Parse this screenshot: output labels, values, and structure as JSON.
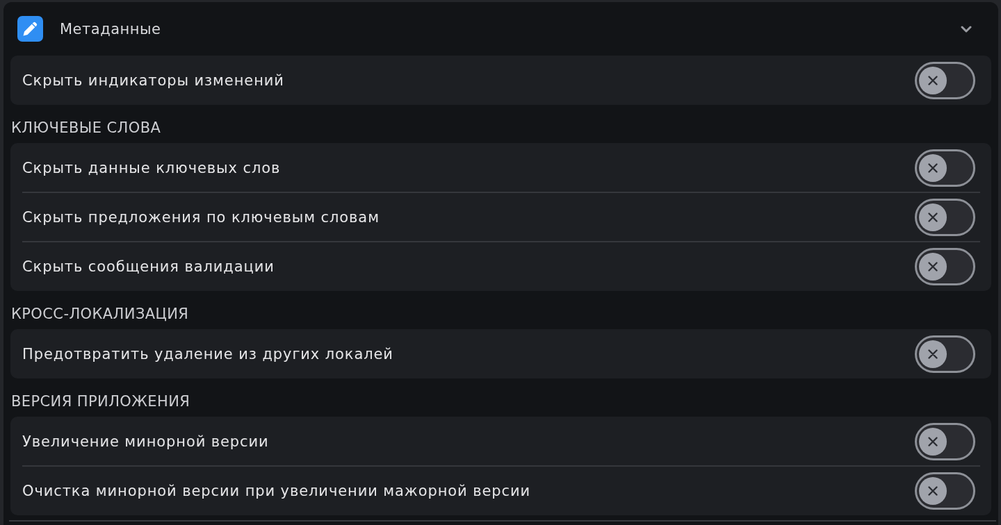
{
  "panel": {
    "title": "Метаданные",
    "expanded": true
  },
  "groups": [
    {
      "items": [
        {
          "label": "Скрыть индикаторы изменений",
          "on": false
        }
      ]
    },
    {
      "heading": "КЛЮЧЕВЫЕ СЛОВА",
      "items": [
        {
          "label": "Скрыть данные ключевых слов",
          "on": false
        },
        {
          "label": "Скрыть предложения по ключевым словам",
          "on": false
        },
        {
          "label": "Скрыть сообщения валидации",
          "on": false
        }
      ]
    },
    {
      "heading": "КРОСС-ЛОКАЛИЗАЦИЯ",
      "items": [
        {
          "label": "Предотвратить удаление из других локалей",
          "on": false
        }
      ]
    },
    {
      "heading": "ВЕРСИЯ ПРИЛОЖЕНИЯ",
      "items": [
        {
          "label": "Увеличение минорной версии",
          "on": false
        },
        {
          "label": "Очистка минорной версии при увеличении мажорной версии",
          "on": false
        }
      ]
    }
  ]
}
